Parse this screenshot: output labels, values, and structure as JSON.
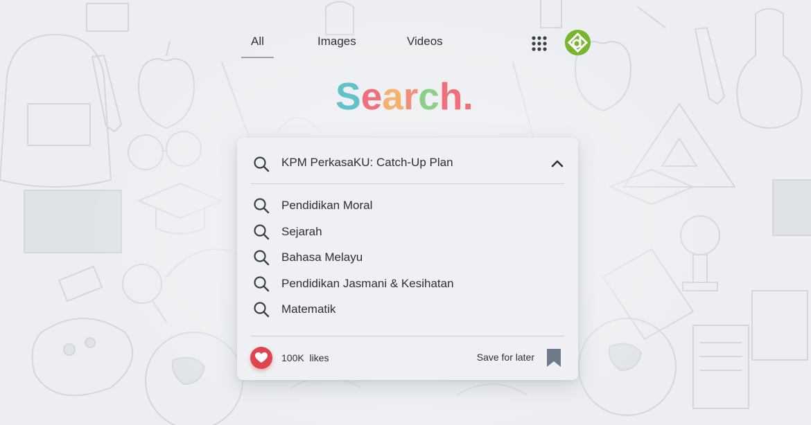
{
  "nav": {
    "tabs": [
      {
        "label": "All",
        "active": true
      },
      {
        "label": "Images",
        "active": false
      },
      {
        "label": "Videos",
        "active": false
      }
    ],
    "apps_icon": "grid-apps-icon",
    "avatar_icon": "profile-logo-icon",
    "avatar_color": "#7ab52f"
  },
  "logo": {
    "letters": [
      {
        "char": "S",
        "color": "#63c2c9"
      },
      {
        "char": "e",
        "color": "#ef6f7a"
      },
      {
        "char": "a",
        "color": "#f4b26e"
      },
      {
        "char": "r",
        "color": "#f0907a"
      },
      {
        "char": "c",
        "color": "#8ccf8a"
      },
      {
        "char": "h",
        "color": "#ef6f7a"
      },
      {
        "char": ".",
        "color": "#ef6f7a"
      }
    ]
  },
  "search": {
    "query": "KPM PerkasaKU: Catch-Up Plan",
    "icon": "search-icon",
    "collapse_icon": "chevron-up-icon"
  },
  "suggestions": [
    "Pendidikan Moral",
    "Sejarah",
    "Bahasa Melayu",
    "Pendidikan Jasmani & Kesihatan",
    "Matematik"
  ],
  "footer": {
    "likes": "100K  likes",
    "like_icon": "heart-icon",
    "like_color": "#e0454d",
    "save_label": "Save for later",
    "bookmark_icon": "bookmark-icon",
    "bookmark_color": "#6d7a8c"
  }
}
